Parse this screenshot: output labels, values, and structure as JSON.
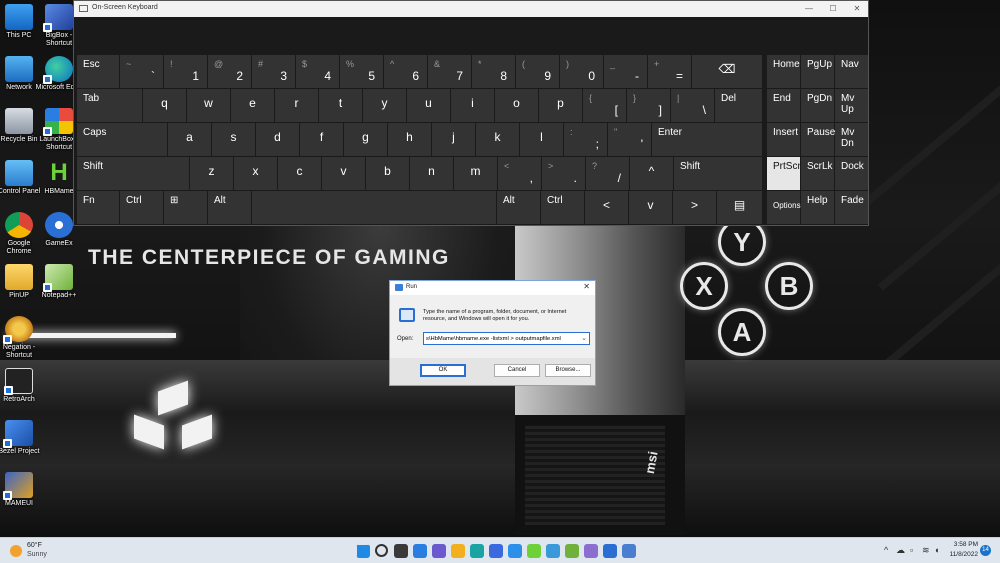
{
  "wallpaper": {
    "tagline": "THE CENTERPIECE OF GAMING",
    "brand": "msi",
    "pad_buttons": [
      "Y",
      "X",
      "B",
      "A"
    ]
  },
  "desktop_icons": [
    {
      "label": "This PC",
      "icon": "computer-icon"
    },
    {
      "label": "BigBox - Shortcut",
      "icon": "bigbox-icon"
    },
    {
      "label": "Network",
      "icon": "network-icon"
    },
    {
      "label": "Microsoft Edge",
      "icon": "edge-icon"
    },
    {
      "label": "Recycle Bin",
      "icon": "recycle-bin-icon"
    },
    {
      "label": "LaunchBox - Shortcut",
      "icon": "launchbox-icon"
    },
    {
      "label": "Control Panel",
      "icon": "control-panel-icon"
    },
    {
      "label": "HBMame",
      "icon": "hbmame-icon"
    },
    {
      "label": "Google Chrome",
      "icon": "chrome-icon"
    },
    {
      "label": "GameEx",
      "icon": "gameex-icon"
    },
    {
      "label": "PinUP",
      "icon": "folder-icon"
    },
    {
      "label": "Notepad++",
      "icon": "notepadpp-icon"
    },
    {
      "label": "Negation - Shortcut",
      "icon": "negation-icon"
    },
    {
      "label": "RetroArch",
      "icon": "retroarch-icon"
    },
    {
      "label": "Bezel Project",
      "icon": "bezel-project-icon"
    },
    {
      "label": "MAMEUI",
      "icon": "mameui-icon"
    }
  ],
  "osk": {
    "title": "On-Screen Keyboard",
    "rows": [
      [
        {
          "main": "Esc"
        },
        {
          "sym": "~",
          "main": "`"
        },
        {
          "sym": "!",
          "main": "1"
        },
        {
          "sym": "@",
          "main": "2"
        },
        {
          "sym": "#",
          "main": "3"
        },
        {
          "sym": "$",
          "main": "4"
        },
        {
          "sym": "%",
          "main": "5"
        },
        {
          "sym": "^",
          "main": "6"
        },
        {
          "sym": "&",
          "main": "7"
        },
        {
          "sym": "*",
          "main": "8"
        },
        {
          "sym": "(",
          "main": "9"
        },
        {
          "sym": ")",
          "main": "0"
        },
        {
          "sym": "_",
          "main": "-"
        },
        {
          "sym": "+",
          "main": "="
        },
        {
          "main": "⌫"
        },
        {
          "main": "Home"
        },
        {
          "main": "PgUp"
        },
        {
          "main": "Nav"
        }
      ],
      [
        {
          "main": "Tab"
        },
        {
          "main": "q"
        },
        {
          "main": "w"
        },
        {
          "main": "e"
        },
        {
          "main": "r"
        },
        {
          "main": "t"
        },
        {
          "main": "y"
        },
        {
          "main": "u"
        },
        {
          "main": "i"
        },
        {
          "main": "o"
        },
        {
          "main": "p"
        },
        {
          "sym": "{",
          "main": "["
        },
        {
          "sym": "}",
          "main": "]"
        },
        {
          "sym": "|",
          "main": "\\"
        },
        {
          "main": "Del"
        },
        {
          "main": "End"
        },
        {
          "main": "PgDn"
        },
        {
          "main": "Mv Up"
        }
      ],
      [
        {
          "main": "Caps"
        },
        {
          "main": "a"
        },
        {
          "main": "s"
        },
        {
          "main": "d"
        },
        {
          "main": "f"
        },
        {
          "main": "g"
        },
        {
          "main": "h"
        },
        {
          "main": "j"
        },
        {
          "main": "k"
        },
        {
          "main": "l"
        },
        {
          "sym": ":",
          "main": ";"
        },
        {
          "sym": "\"",
          "main": "'"
        },
        {
          "main": "Enter"
        },
        {
          "main": "Insert"
        },
        {
          "main": "Pause"
        },
        {
          "main": "Mv Dn"
        }
      ],
      [
        {
          "main": "Shift"
        },
        {
          "main": "z"
        },
        {
          "main": "x"
        },
        {
          "main": "c"
        },
        {
          "main": "v"
        },
        {
          "main": "b"
        },
        {
          "main": "n"
        },
        {
          "main": "m"
        },
        {
          "sym": "<",
          "main": ","
        },
        {
          "sym": ">",
          "main": "."
        },
        {
          "sym": "?",
          "main": "/"
        },
        {
          "main": "^"
        },
        {
          "main": "Shift"
        },
        {
          "main": "PrtScn"
        },
        {
          "main": "ScrLk"
        },
        {
          "main": "Dock"
        }
      ],
      [
        {
          "main": "Fn"
        },
        {
          "main": "Ctrl"
        },
        {
          "main": "⊞"
        },
        {
          "main": "Alt"
        },
        {
          "main": ""
        },
        {
          "main": "Alt"
        },
        {
          "main": "Ctrl"
        },
        {
          "main": "<"
        },
        {
          "main": "v"
        },
        {
          "main": ">"
        },
        {
          "main": "▤"
        },
        {
          "main": "Options"
        },
        {
          "main": "Help"
        },
        {
          "main": "Fade"
        }
      ]
    ],
    "highlighted_key": "PrtScn"
  },
  "run_dialog": {
    "title": "Run",
    "description": "Type the name of a program, folder, document, or Internet resource, and Windows will open it for you.",
    "open_label": "Open:",
    "command": "s\\HbMame\\hbmame.exe -listxml > outputmapfile.xml",
    "ok_label": "OK",
    "cancel_label": "Cancel",
    "browse_label": "Browse..."
  },
  "taskbar": {
    "weather_temp": "60°F",
    "weather_condition": "Sunny",
    "pinned": [
      "windows-start-icon",
      "search-icon",
      "task-view-icon",
      "widgets-icon",
      "chat-icon",
      "file-explorer-icon",
      "edge-icon",
      "store-icon",
      "photos-icon",
      "hbmame-icon",
      "control-panel-icon",
      "notepadpp-icon",
      "mame-icon",
      "run-icon",
      "keyboard-icon"
    ],
    "time": "3:58 PM",
    "date": "11/8/2022",
    "notifications": "14"
  }
}
